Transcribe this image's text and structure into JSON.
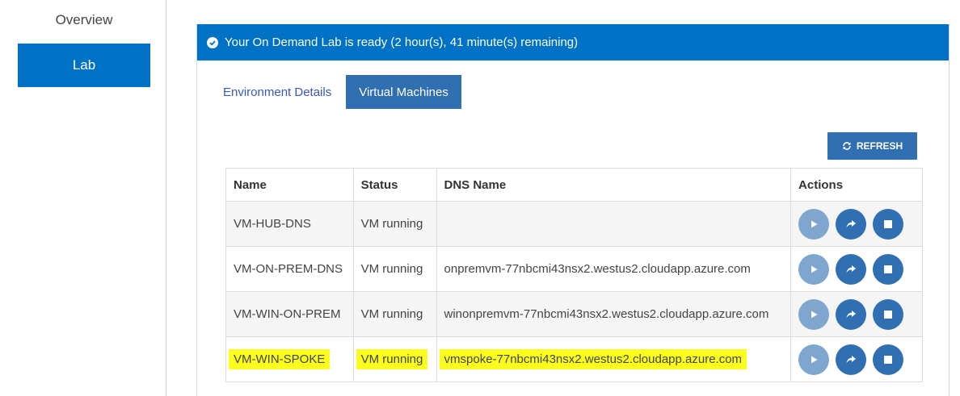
{
  "nav": {
    "overview_label": "Overview",
    "lab_label": "Lab"
  },
  "banner": {
    "text": "Your On Demand Lab is ready (2 hour(s), 41 minute(s) remaining)"
  },
  "tabs": [
    {
      "label": "Environment Details"
    },
    {
      "label": "Virtual Machines"
    }
  ],
  "refresh_label": "REFRESH",
  "table": {
    "headers": {
      "name": "Name",
      "status": "Status",
      "dns": "DNS Name",
      "actions": "Actions"
    },
    "rows": [
      {
        "name": "VM-HUB-DNS",
        "status": "VM running",
        "dns": ""
      },
      {
        "name": "VM-ON-PREM-DNS",
        "status": "VM running",
        "dns": "onpremvm-77nbcmi43nsx2.westus2.cloudapp.azure.com"
      },
      {
        "name": "VM-WIN-ON-PREM",
        "status": "VM running",
        "dns": "winonpremvm-77nbcmi43nsx2.westus2.cloudapp.azure.com"
      },
      {
        "name": "VM-WIN-SPOKE",
        "status": "VM running",
        "dns": "vmspoke-77nbcmi43nsx2.westus2.cloudapp.azure.com"
      }
    ]
  },
  "colors": {
    "accent": "#0072c6",
    "button": "#2f6fb2",
    "button_disabled": "#7fa6cf",
    "highlight": "#fbfd1d"
  },
  "icons": {
    "banner": "check-circle-icon",
    "refresh": "refresh-icon",
    "start": "play-icon",
    "restart": "share-arrow-icon",
    "stop": "stop-icon"
  }
}
